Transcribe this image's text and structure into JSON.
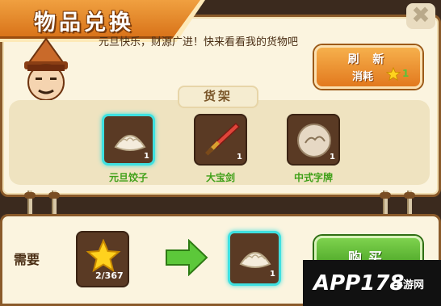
{
  "window": {
    "title": "物品兑换",
    "close_symbol": "✖"
  },
  "merchant": {
    "greeting": "元旦快乐，财源广进！快来看看我的货物吧"
  },
  "refresh": {
    "label": "刷 新",
    "cost_label": "消耗",
    "cost_icon": "star-icon",
    "cost_value": "1"
  },
  "shelf": {
    "title": "货架",
    "items": [
      {
        "name": "元旦饺子",
        "count": "1",
        "icon": "dumpling-icon",
        "selected": true
      },
      {
        "name": "大宝剑",
        "count": "1",
        "icon": "sword-icon",
        "selected": false
      },
      {
        "name": "中式字牌",
        "count": "1",
        "icon": "plaque-icon",
        "selected": false
      }
    ]
  },
  "exchange": {
    "need_label": "需要",
    "cost_icon": "star-icon",
    "cost_amount": "2/367",
    "result_icon": "dumpling-icon",
    "result_count": "1",
    "buy_label": "购买"
  },
  "watermark": {
    "text": "APP178",
    "subtext": "手游网"
  },
  "colors": {
    "title_orange": "#e8882c",
    "parchment": "#fbf4df",
    "highlight_cyan": "#3fe0e0",
    "item_name_green": "#3fa018",
    "buy_green": "#5cb834"
  }
}
